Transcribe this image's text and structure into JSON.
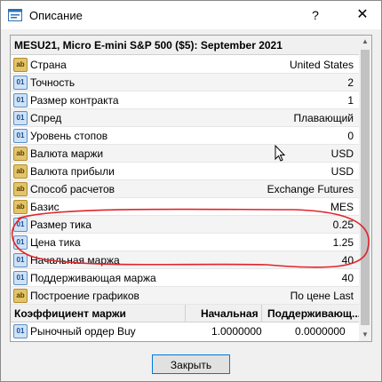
{
  "window": {
    "title": "Описание",
    "help_glyph": "?",
    "close_glyph": "✕",
    "icon": "app-window-icon"
  },
  "symbol_header": "MESU21, Micro E-mini S&P 500 ($5): September 2021",
  "properties": [
    {
      "icon": "ab",
      "label": "Страна",
      "value": "United States"
    },
    {
      "icon": "01",
      "label": "Точность",
      "value": "2"
    },
    {
      "icon": "01",
      "label": "Размер контракта",
      "value": "1"
    },
    {
      "icon": "01",
      "label": "Спред",
      "value": "Плавающий"
    },
    {
      "icon": "01",
      "label": "Уровень стопов",
      "value": "0"
    },
    {
      "icon": "ab",
      "label": "Валюта маржи",
      "value": "USD"
    },
    {
      "icon": "ab",
      "label": "Валюта прибыли",
      "value": "USD"
    },
    {
      "icon": "ab",
      "label": "Способ расчетов",
      "value": "Exchange Futures"
    },
    {
      "icon": "ab",
      "label": "Базис",
      "value": "MES"
    },
    {
      "icon": "01",
      "label": "Размер тика",
      "value": "0.25"
    },
    {
      "icon": "01",
      "label": "Цена тика",
      "value": "1.25"
    },
    {
      "icon": "01",
      "label": "Начальная маржа",
      "value": "40"
    },
    {
      "icon": "01",
      "label": "Поддерживающая маржа",
      "value": "40"
    },
    {
      "icon": "ab",
      "label": "Построение графиков",
      "value": "По цене Last"
    }
  ],
  "margin_table": {
    "headers": [
      "Коэффициент маржи",
      "Начальная",
      "Поддерживающ..."
    ],
    "rows": [
      {
        "icon": "01",
        "label": "Рыночный ордер Buy",
        "initial": "1.0000000",
        "maintenance": "0.0000000"
      }
    ]
  },
  "scrollbar": {
    "up_glyph": "▲",
    "down_glyph": "▼"
  },
  "buttons": {
    "close_label": "Закрыть"
  },
  "colors": {
    "annotation": "#e0242b",
    "button_border": "#0078d7"
  }
}
